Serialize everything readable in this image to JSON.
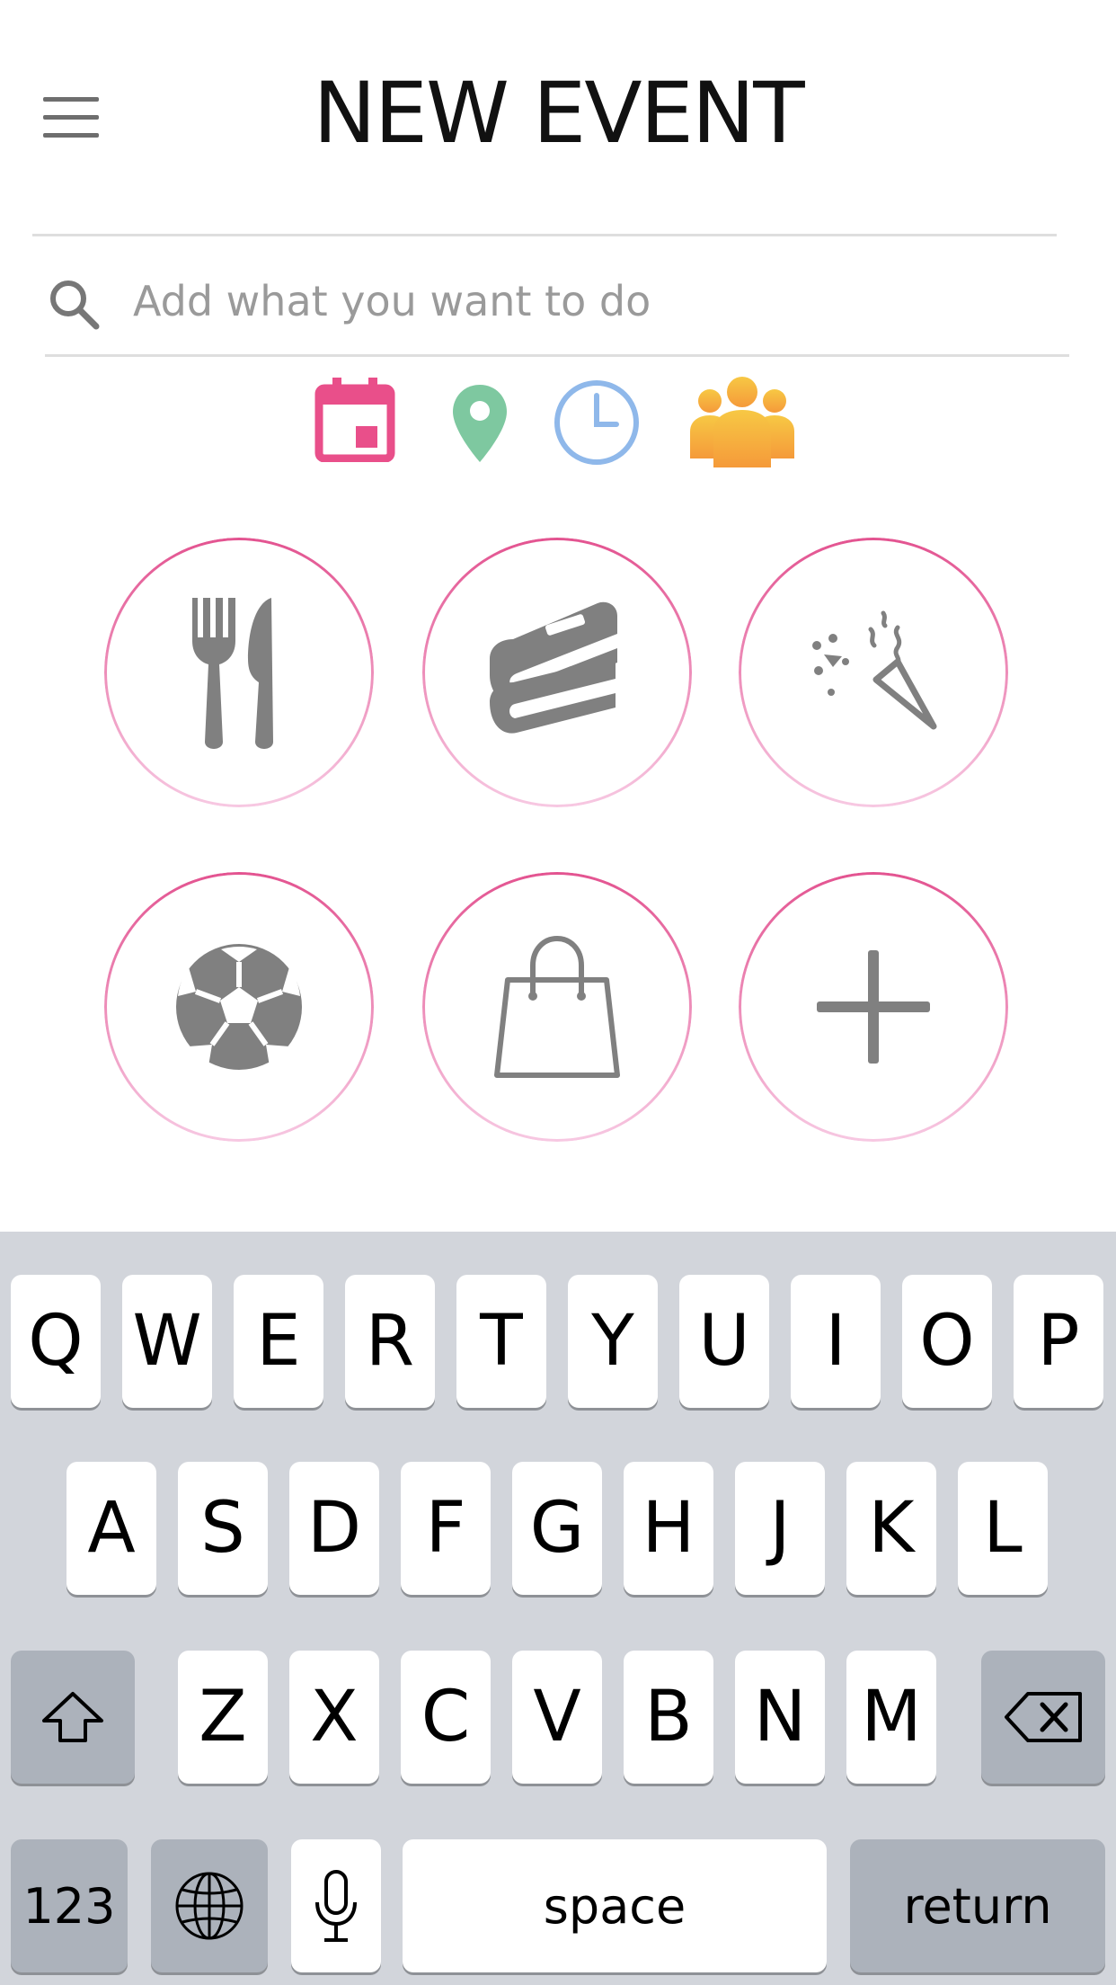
{
  "header": {
    "title": "NEW EVENT",
    "menu_icon": "hamburger-menu-icon"
  },
  "search": {
    "placeholder": "Add what you want to do",
    "value": "",
    "icon": "search-icon"
  },
  "quick_actions": [
    {
      "name": "calendar-icon",
      "color": "#e94f8a"
    },
    {
      "name": "location-pin-icon",
      "color": "#7ec8a0"
    },
    {
      "name": "clock-icon",
      "color": "#8fb8ea"
    },
    {
      "name": "group-people-icon",
      "color": "#f5b642"
    }
  ],
  "categories": [
    {
      "name": "food-icon"
    },
    {
      "name": "books-icon"
    },
    {
      "name": "party-popper-icon"
    },
    {
      "name": "soccer-ball-icon"
    },
    {
      "name": "shopping-bag-icon"
    },
    {
      "name": "add-icon"
    }
  ],
  "colors": {
    "accent": "#e35390",
    "icon_gray": "#808080",
    "keyboard_bg": "#d2d5db"
  },
  "keyboard": {
    "row1": [
      "Q",
      "W",
      "E",
      "R",
      "T",
      "Y",
      "U",
      "I",
      "O",
      "P"
    ],
    "row2": [
      "A",
      "S",
      "D",
      "F",
      "G",
      "H",
      "J",
      "K",
      "L"
    ],
    "row3": [
      "Z",
      "X",
      "C",
      "V",
      "B",
      "N",
      "M"
    ],
    "numbers_label": "123",
    "space_label": "space",
    "return_label": "return"
  }
}
